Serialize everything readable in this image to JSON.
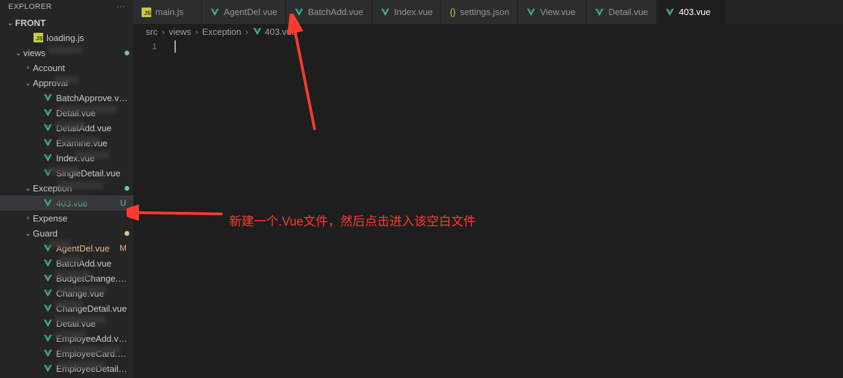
{
  "sidebar": {
    "title": "EXPLORER",
    "root": "FRONT",
    "tree": [
      {
        "type": "file",
        "indent": 2,
        "icon": "js",
        "label": "loading.js"
      },
      {
        "type": "folder",
        "indent": 1,
        "icon": "dir",
        "label": "views",
        "expanded": true,
        "dot": "u"
      },
      {
        "type": "folder",
        "indent": 2,
        "icon": "dir",
        "label": "Account",
        "expanded": false
      },
      {
        "type": "folder",
        "indent": 2,
        "icon": "dir",
        "label": "Approval",
        "expanded": true
      },
      {
        "type": "file",
        "indent": 3,
        "icon": "vue",
        "label": "BatchApprove.vue"
      },
      {
        "type": "file",
        "indent": 3,
        "icon": "vue",
        "label": "Detail.vue"
      },
      {
        "type": "file",
        "indent": 3,
        "icon": "vue",
        "label": "DetailAdd.vue"
      },
      {
        "type": "file",
        "indent": 3,
        "icon": "vue",
        "label": "Examine.vue"
      },
      {
        "type": "file",
        "indent": 3,
        "icon": "vue",
        "label": "Index.vue"
      },
      {
        "type": "file",
        "indent": 3,
        "icon": "vue",
        "label": "SingleDetail.vue"
      },
      {
        "type": "folder",
        "indent": 2,
        "icon": "dir",
        "label": "Exception",
        "expanded": true,
        "dot": "u"
      },
      {
        "type": "file",
        "indent": 3,
        "icon": "vue",
        "label": "403.vue",
        "status": "U",
        "selected": true
      },
      {
        "type": "folder",
        "indent": 2,
        "icon": "dir",
        "label": "Expense",
        "expanded": false
      },
      {
        "type": "folder",
        "indent": 2,
        "icon": "dir",
        "label": "Guard",
        "expanded": true,
        "dot": "m"
      },
      {
        "type": "file",
        "indent": 3,
        "icon": "vue",
        "label": "AgentDel.vue",
        "status": "M"
      },
      {
        "type": "file",
        "indent": 3,
        "icon": "vue",
        "label": "BatchAdd.vue"
      },
      {
        "type": "file",
        "indent": 3,
        "icon": "vue",
        "label": "BudgetChange.vue"
      },
      {
        "type": "file",
        "indent": 3,
        "icon": "vue",
        "label": "Change.vue"
      },
      {
        "type": "file",
        "indent": 3,
        "icon": "vue",
        "label": "ChangeDetail.vue"
      },
      {
        "type": "file",
        "indent": 3,
        "icon": "vue",
        "label": "Detail.vue"
      },
      {
        "type": "file",
        "indent": 3,
        "icon": "vue",
        "label": "EmployeeAdd.vue"
      },
      {
        "type": "file",
        "indent": 3,
        "icon": "vue",
        "label": "EmployeeCard.vue"
      },
      {
        "type": "file",
        "indent": 3,
        "icon": "vue",
        "label": "EmployeeDetail.vue"
      }
    ]
  },
  "tabs": [
    {
      "icon": "js",
      "label": "main.js",
      "active": false
    },
    {
      "icon": "vue",
      "label": "AgentDel.vue",
      "active": false
    },
    {
      "icon": "vue",
      "label": "BatchAdd.vue",
      "active": false
    },
    {
      "icon": "vue",
      "label": "Index.vue",
      "active": false
    },
    {
      "icon": "json",
      "label": "settings.json",
      "active": false
    },
    {
      "icon": "vue",
      "label": "View.vue",
      "active": false
    },
    {
      "icon": "vue",
      "label": "Detail.vue",
      "active": false
    },
    {
      "icon": "vue",
      "label": "403.vue",
      "active": true
    }
  ],
  "breadcrumb": [
    {
      "label": "src"
    },
    {
      "label": "views"
    },
    {
      "label": "Exception"
    },
    {
      "label": "403.vue",
      "icon": "vue"
    }
  ],
  "editor": {
    "line_numbers": [
      "1"
    ]
  },
  "annotation": {
    "text": "新建一个.Vue文件，然后点击进入该空白文件"
  }
}
